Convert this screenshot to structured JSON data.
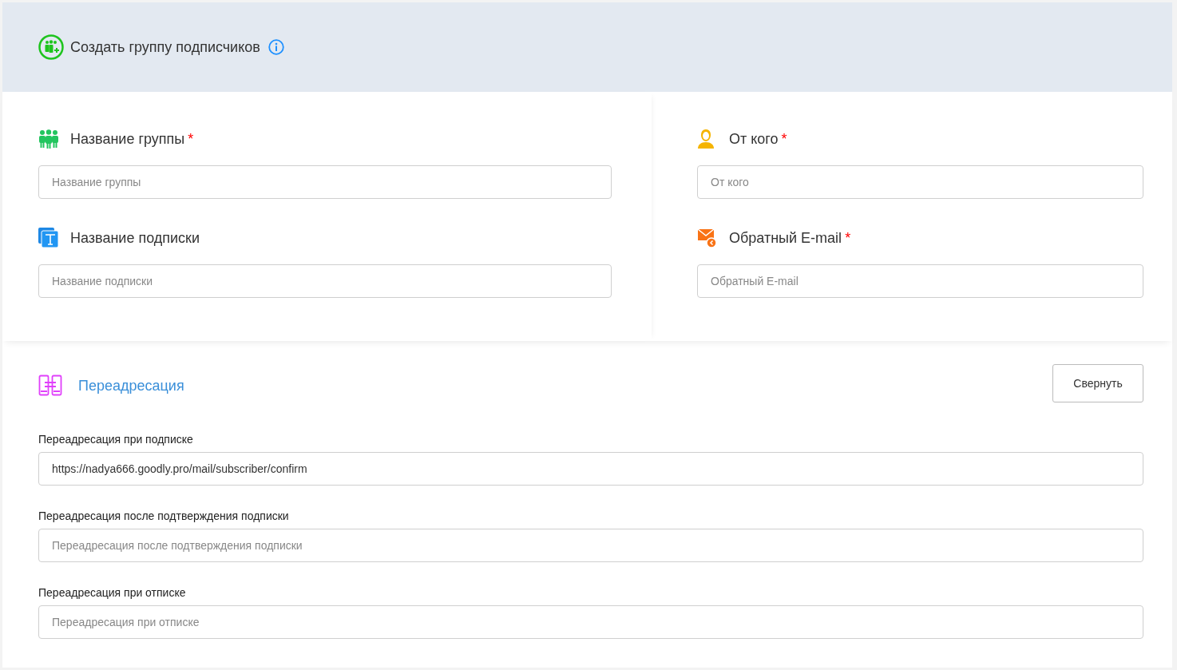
{
  "header": {
    "title": "Создать группу подписчиков"
  },
  "left_fields": [
    {
      "kind": "group",
      "label": "Название группы",
      "asterisk": "*",
      "placeholder": "Название группы"
    },
    {
      "kind": "text",
      "label": "Название подписки",
      "placeholder": "Название подписки"
    }
  ],
  "right_fields": [
    {
      "kind": "person",
      "label": "От кого",
      "asterisk": "*",
      "placeholder": "От кого"
    },
    {
      "kind": "mail",
      "label": "Обратный E-mail",
      "asterisk": "*",
      "placeholder": "Обратный E-mail"
    }
  ],
  "redirect": {
    "title": "Переадресация",
    "collapse_button": "Свернуть",
    "fields": [
      {
        "label": "Переадресация при подписке",
        "value": "https://nadya666.goodly.pro/mail/subscriber/confirm"
      },
      {
        "label": "Переадресация после подтверждения подписки",
        "placeholder": "Переадресация после подтверждения подписки"
      },
      {
        "label": "Переадресация при отписке",
        "placeholder": "Переадресация при отписке"
      }
    ]
  }
}
